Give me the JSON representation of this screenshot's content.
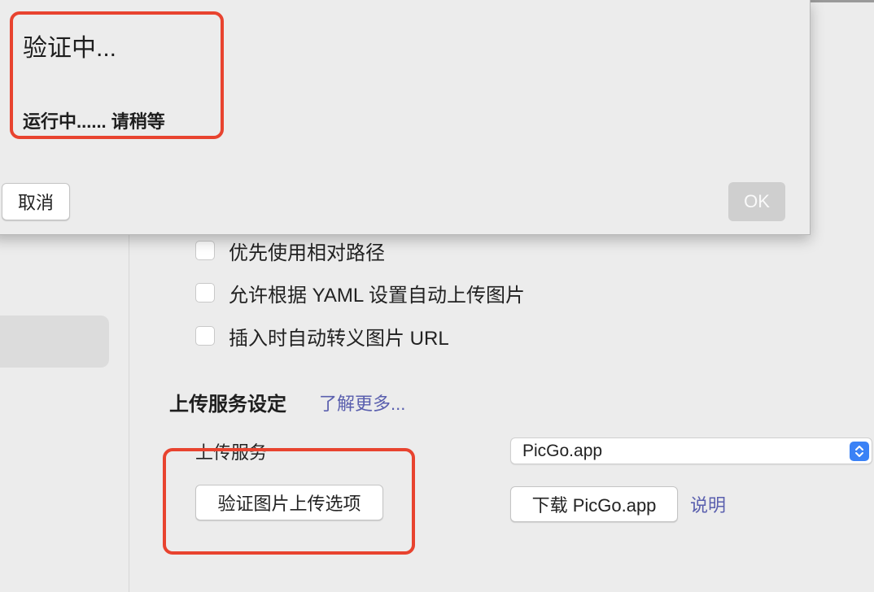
{
  "dialog": {
    "title": "验证中...",
    "message": "运行中...... 请稍等",
    "cancel_label": "取消",
    "ok_label": "OK"
  },
  "checkboxes": [
    {
      "label": "优先使用相对路径",
      "checked": false
    },
    {
      "label": "允许根据 YAML 设置自动上传图片",
      "checked": false
    },
    {
      "label": "插入时自动转义图片 URL",
      "checked": false
    }
  ],
  "upload_section": {
    "title": "上传服务设定",
    "learn_more": "了解更多...",
    "service_label": "上传服务",
    "service_value": "PicGo.app",
    "verify_button": "验证图片上传选项",
    "download_button": "下载 PicGo.app",
    "explain_link": "说明"
  },
  "colors": {
    "annotation": "#e8432f",
    "link": "#5a5fae",
    "select_accent": "#3b82f6"
  },
  "icons": {
    "select_stepper": "chevron-up-down-icon"
  }
}
